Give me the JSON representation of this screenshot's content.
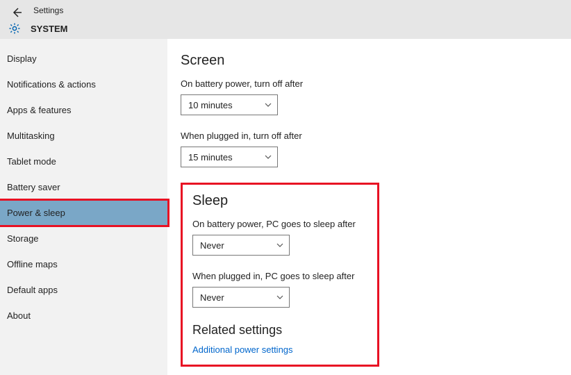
{
  "header": {
    "settings_label": "Settings",
    "system_title": "SYSTEM"
  },
  "sidebar": {
    "items": [
      {
        "label": "Display"
      },
      {
        "label": "Notifications & actions"
      },
      {
        "label": "Apps & features"
      },
      {
        "label": "Multitasking"
      },
      {
        "label": "Tablet mode"
      },
      {
        "label": "Battery saver"
      },
      {
        "label": "Power & sleep"
      },
      {
        "label": "Storage"
      },
      {
        "label": "Offline maps"
      },
      {
        "label": "Default apps"
      },
      {
        "label": "About"
      }
    ]
  },
  "content": {
    "screen": {
      "heading": "Screen",
      "battery_label": "On battery power, turn off after",
      "battery_value": "10 minutes",
      "plugged_label": "When plugged in, turn off after",
      "plugged_value": "15 minutes"
    },
    "sleep": {
      "heading": "Sleep",
      "battery_label": "On battery power, PC goes to sleep after",
      "battery_value": "Never",
      "plugged_label": "When plugged in, PC goes to sleep after",
      "plugged_value": "Never"
    },
    "related": {
      "heading": "Related settings",
      "link": "Additional power settings"
    }
  }
}
